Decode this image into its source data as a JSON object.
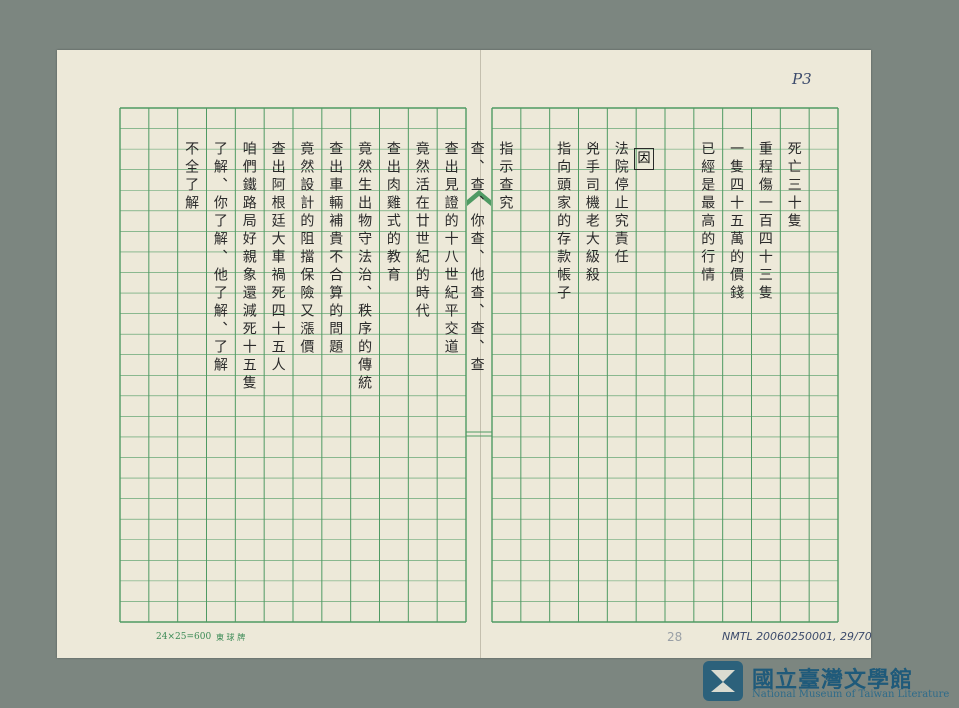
{
  "manuscript": {
    "page_mark": "P3",
    "sheet_number": "28",
    "paper_spec": "24×25=600",
    "paper_brand": "東 球 牌",
    "archive_id": "NMTL 20060250001, 29/70",
    "boxed_char": "因",
    "circled_char": "三",
    "columns": [
      {
        "text": "死亡三十隻"
      },
      {
        "text": "重程傷一百四十三隻"
      },
      {
        "text": "一隻四十五萬的價錢"
      },
      {
        "text": "已經是最高的行情"
      },
      {
        "text": ""
      },
      {
        "text": ""
      },
      {
        "text": "法院停止究責任"
      },
      {
        "text": "兇手司機老大級殺"
      },
      {
        "text": "指向頭家的存款帳子"
      },
      {
        "text": ""
      },
      {
        "text": "指示查究"
      },
      {
        "text": "查、查、你查、他查、查、查"
      },
      {
        "text": "查出見證的十八世紀平交道"
      },
      {
        "text": "竟然活在廿世紀的時代"
      },
      {
        "text": "查出肉雞式的教育"
      },
      {
        "text": "竟然生出物守法治、秩序的傳統"
      },
      {
        "text": "查出車輛補貴不合算的問題"
      },
      {
        "text": "竟然設計的阻擋保險又漲價"
      },
      {
        "text": "查出阿根廷大車禍死四十五人"
      },
      {
        "text": "咱們鐵路局好親象還減死十五隻"
      },
      {
        "text": "了解、你了解、他了解、了解"
      },
      {
        "text": "不全了解"
      }
    ]
  },
  "logo": {
    "title": "國立臺灣文學館",
    "subtitle": "National Museum of Taiwan Literature"
  },
  "colors": {
    "grid": "#4f9a63",
    "paper": "#ede9d9",
    "background": "#7c8680",
    "logo": "#1f5a7a"
  }
}
